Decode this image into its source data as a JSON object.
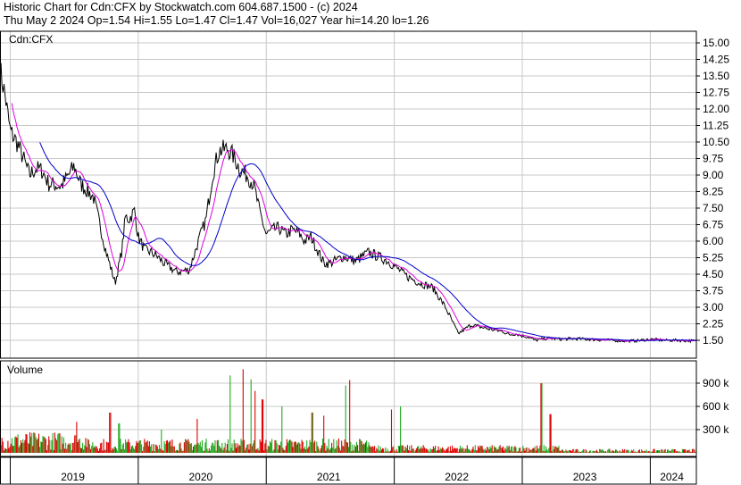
{
  "header": {
    "line1": "Historic Chart for Cdn:CFX by Stockwatch.com 604.687.1500 - (c) 2024",
    "line2": "Thu May  2 2024   Op=1.54   Hi=1.55   Lo=1.47   Cl=1.47   Vol=16,027   Year hi=14.20   lo=1.26"
  },
  "chart_data": {
    "type": "line",
    "symbol": "Cdn:CFX",
    "price_ylim": [
      1.0,
      15.5
    ],
    "price_ticks": [
      "15.00",
      "14.25",
      "13.50",
      "12.75",
      "12.00",
      "11.25",
      "10.50",
      "9.75",
      "9.00",
      "8.25",
      "7.50",
      "6.75",
      "6.00",
      "5.25",
      "4.50",
      "3.75",
      "3.00",
      "2.25",
      "1.50"
    ],
    "volume_title": "Volume",
    "volume_ticks": [
      "900 k",
      "600 k",
      "300 k"
    ],
    "volume_ylim": [
      0,
      1100
    ],
    "years": [
      "2019",
      "2020",
      "2021",
      "2022",
      "2023",
      "2024"
    ],
    "x_range": [
      2018.92,
      2024.36
    ],
    "price_key": {
      "x": [
        2018.92,
        2018.96,
        2019.0,
        2019.05,
        2019.1,
        2019.15,
        2019.2,
        2019.25,
        2019.3,
        2019.4,
        2019.5,
        2019.55,
        2019.65,
        2019.75,
        2019.82,
        2019.87,
        2019.9,
        2019.93,
        2019.97,
        2020.0,
        2020.05,
        2020.1,
        2020.15,
        2020.2,
        2020.3,
        2020.4,
        2020.47,
        2020.53,
        2020.58,
        2020.63,
        2020.7,
        2020.75,
        2020.8,
        2020.85,
        2020.9,
        2020.95,
        2021.0,
        2021.05,
        2021.1,
        2021.15,
        2021.2,
        2021.25,
        2021.3,
        2021.35,
        2021.45,
        2021.5,
        2021.6,
        2021.7,
        2021.8,
        2021.95,
        2022.1,
        2022.2,
        2022.3,
        2022.4,
        2022.5,
        2022.6,
        2022.75,
        2022.85,
        2022.9,
        2022.95,
        2023.0,
        2023.05,
        2023.1,
        2023.2,
        2023.3,
        2023.4,
        2023.5,
        2023.6,
        2023.7,
        2023.8,
        2023.9,
        2024.0,
        2024.1,
        2024.2,
        2024.3,
        2024.36
      ],
      "y": [
        13.8,
        12.6,
        11.0,
        10.5,
        9.8,
        9.0,
        9.3,
        9.2,
        8.6,
        8.5,
        9.4,
        8.6,
        8.0,
        5.5,
        4.1,
        5.5,
        7.1,
        7.0,
        7.4,
        6.2,
        5.6,
        5.5,
        5.3,
        5.0,
        4.6,
        4.7,
        6.0,
        7.0,
        9.0,
        10.1,
        10.2,
        9.8,
        9.2,
        9.0,
        8.6,
        7.3,
        6.3,
        6.5,
        6.6,
        6.3,
        6.5,
        6.4,
        6.0,
        6.2,
        5.0,
        5.0,
        5.3,
        5.1,
        5.5,
        5.1,
        4.4,
        4.1,
        3.9,
        3.0,
        1.8,
        2.2,
        2.0,
        1.9,
        1.75,
        1.8,
        1.7,
        1.65,
        1.5,
        1.6,
        1.55,
        1.58,
        1.55,
        1.52,
        1.5,
        1.47,
        1.48,
        1.55,
        1.5,
        1.5,
        1.48,
        1.47
      ]
    },
    "volume_spikes": {
      "x": [
        2019.52,
        2019.78,
        2019.85,
        2020.18,
        2020.46,
        2020.72,
        2020.82,
        2020.88,
        2020.91,
        2020.97,
        2021.12,
        2021.36,
        2021.45,
        2021.62,
        2021.65,
        2021.98,
        2022.05,
        2023.15,
        2023.22
      ],
      "y": [
        400,
        520,
        380,
        300,
        440,
        1000,
        1080,
        950,
        800,
        690,
        600,
        520,
        480,
        870,
        940,
        560,
        600,
        900,
        500
      ]
    },
    "colors": {
      "price": "#000000",
      "ma_short": "#dd00dd",
      "ma_long": "#0000cc",
      "vol_up": "#22aa22",
      "vol_down": "#dd0000",
      "grid": "#c8c8c8",
      "axis": "#000000"
    }
  }
}
